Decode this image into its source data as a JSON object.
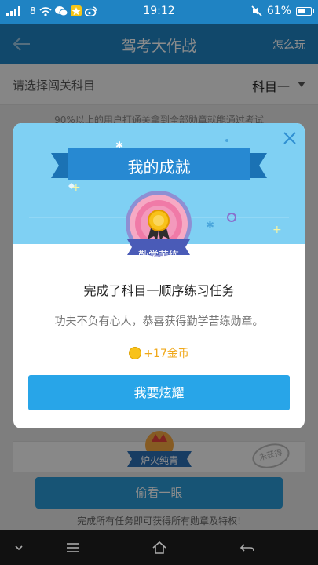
{
  "statusbar": {
    "carrier_glyph": "8",
    "time": "19:12",
    "battery": "61%",
    "battery_level": 0.61
  },
  "navbar": {
    "title": "驾考大作战",
    "help": "怎么玩"
  },
  "subject": {
    "label": "请选择闯关科目",
    "value": "科目一"
  },
  "hint": "90%以上的用户打通关拿到全部勋章就能通过考试",
  "background": {
    "medal_name": "炉火纯青",
    "stamp": "未获得",
    "peek_button": "偷看一眼",
    "footer": "完成所有任务即可获得所有勋章及特权!"
  },
  "dialog": {
    "title": "我的成就",
    "medal_name": "勤学苦练",
    "task": "完成了科目一顺序练习任务",
    "description": "功夫不负有心人，恭喜获得勤学苦练勋章。",
    "coins": "+17金币",
    "share_button": "我要炫耀"
  },
  "colors": {
    "brand": "#1f83c3",
    "button": "#28a5e8",
    "banner": "#7fd0f3",
    "coin": "#f0a81a"
  },
  "icons": [
    "back-icon",
    "caret-down-icon",
    "close-icon",
    "medal-icon",
    "coin-icon",
    "nav-down-icon",
    "menu-icon",
    "home-icon",
    "return-icon"
  ]
}
